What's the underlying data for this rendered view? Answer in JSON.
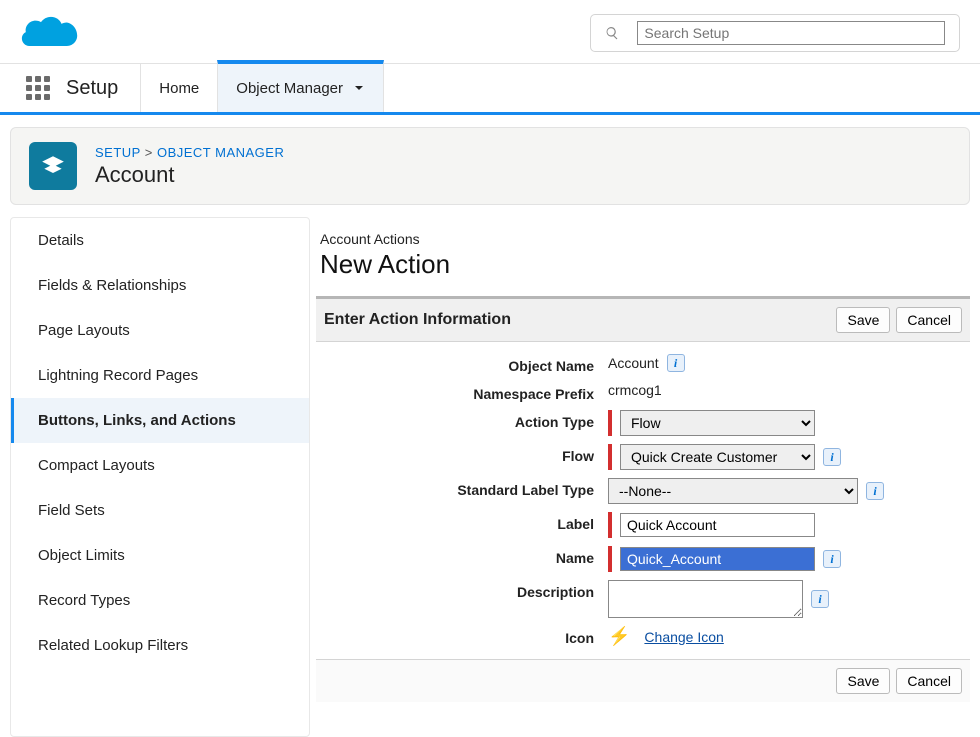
{
  "search": {
    "placeholder": "Search Setup"
  },
  "brand": "Setup",
  "tabs": {
    "home": "Home",
    "objmgr": "Object Manager"
  },
  "breadcrumb": {
    "a": "SETUP",
    "sep": ">",
    "b": "OBJECT MANAGER"
  },
  "obj": "Account",
  "sidebar": {
    "items": [
      "Details",
      "Fields & Relationships",
      "Page Layouts",
      "Lightning Record Pages",
      "Buttons, Links, and Actions",
      "Compact Layouts",
      "Field Sets",
      "Object Limits",
      "Record Types",
      "Related Lookup Filters"
    ]
  },
  "main": {
    "subhead": "Account Actions",
    "title": "New Action",
    "section_title": "Enter Action Information",
    "save": "Save",
    "cancel": "Cancel",
    "labels": {
      "object_name": "Object Name",
      "namespace": "Namespace Prefix",
      "action_type": "Action Type",
      "flow": "Flow",
      "std_label": "Standard Label Type",
      "label": "Label",
      "name": "Name",
      "description": "Description",
      "icon": "Icon"
    },
    "values": {
      "object_name": "Account",
      "namespace": "crmcog1",
      "action_type": "Flow",
      "flow": "Quick Create Customer",
      "std_label": "--None--",
      "label": "Quick Account",
      "name": "Quick_Account",
      "change_icon": "Change Icon"
    }
  }
}
